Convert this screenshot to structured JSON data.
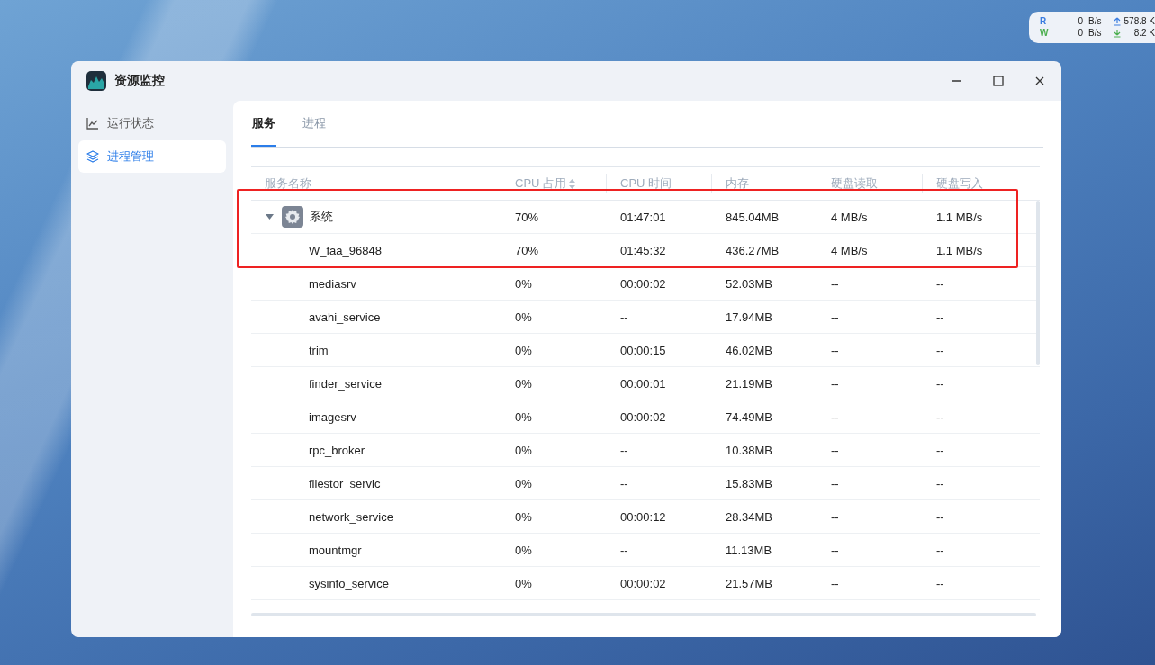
{
  "net_widget": {
    "rows": [
      {
        "label": "R",
        "color": "#3b7de0",
        "value": "0",
        "unit": "B/s",
        "kind": "upload",
        "rate": "578.8 K"
      },
      {
        "label": "W",
        "color": "#4caf50",
        "value": "0",
        "unit": "B/s",
        "kind": "download",
        "rate": "8.2 K"
      }
    ]
  },
  "window": {
    "title": "资源监控"
  },
  "sidebar": {
    "items": [
      {
        "label": "运行状态",
        "selected": false
      },
      {
        "label": "进程管理",
        "selected": true
      }
    ]
  },
  "tabs": [
    {
      "label": "服务",
      "selected": true
    },
    {
      "label": "进程",
      "selected": false
    }
  ],
  "table": {
    "columns": [
      {
        "label": "服务名称",
        "sortable": false
      },
      {
        "label": "CPU 占用",
        "sortable": true
      },
      {
        "label": "CPU 时间",
        "sortable": false
      },
      {
        "label": "内存",
        "sortable": false
      },
      {
        "label": "硬盘读取",
        "sortable": false
      },
      {
        "label": "硬盘写入",
        "sortable": false
      }
    ],
    "rows": [
      {
        "name": "系统",
        "cpu": "70%",
        "cpu_time": "01:47:01",
        "memory": "845.04MB",
        "disk_read": "4 MB/s",
        "disk_write": "1.1 MB/s",
        "expanded": true,
        "highlighted": true,
        "children": [
          {
            "name": "W_faa_96848",
            "cpu": "70%",
            "cpu_time": "01:45:32",
            "memory": "436.27MB",
            "disk_read": "4 MB/s",
            "disk_write": "1.1 MB/s",
            "highlighted": true
          },
          {
            "name": "mediasrv",
            "cpu": "0%",
            "cpu_time": "00:00:02",
            "memory": "52.03MB",
            "disk_read": "--",
            "disk_write": "--",
            "highlighted": false
          },
          {
            "name": "avahi_service",
            "cpu": "0%",
            "cpu_time": "--",
            "memory": "17.94MB",
            "disk_read": "--",
            "disk_write": "--",
            "highlighted": false
          },
          {
            "name": "trim",
            "cpu": "0%",
            "cpu_time": "00:00:15",
            "memory": "46.02MB",
            "disk_read": "--",
            "disk_write": "--",
            "highlighted": false
          },
          {
            "name": "finder_service",
            "cpu": "0%",
            "cpu_time": "00:00:01",
            "memory": "21.19MB",
            "disk_read": "--",
            "disk_write": "--",
            "highlighted": false
          },
          {
            "name": "imagesrv",
            "cpu": "0%",
            "cpu_time": "00:00:02",
            "memory": "74.49MB",
            "disk_read": "--",
            "disk_write": "--",
            "highlighted": false
          },
          {
            "name": "rpc_broker",
            "cpu": "0%",
            "cpu_time": "--",
            "memory": "10.38MB",
            "disk_read": "--",
            "disk_write": "--",
            "highlighted": false
          },
          {
            "name": "filestor_servic",
            "cpu": "0%",
            "cpu_time": "--",
            "memory": "15.83MB",
            "disk_read": "--",
            "disk_write": "--",
            "highlighted": false
          },
          {
            "name": "network_service",
            "cpu": "0%",
            "cpu_time": "00:00:12",
            "memory": "28.34MB",
            "disk_read": "--",
            "disk_write": "--",
            "highlighted": false
          },
          {
            "name": "mountmgr",
            "cpu": "0%",
            "cpu_time": "--",
            "memory": "11.13MB",
            "disk_read": "--",
            "disk_write": "--",
            "highlighted": false
          },
          {
            "name": "sysinfo_service",
            "cpu": "0%",
            "cpu_time": "00:00:02",
            "memory": "21.57MB",
            "disk_read": "--",
            "disk_write": "--",
            "highlighted": false
          }
        ]
      }
    ]
  }
}
